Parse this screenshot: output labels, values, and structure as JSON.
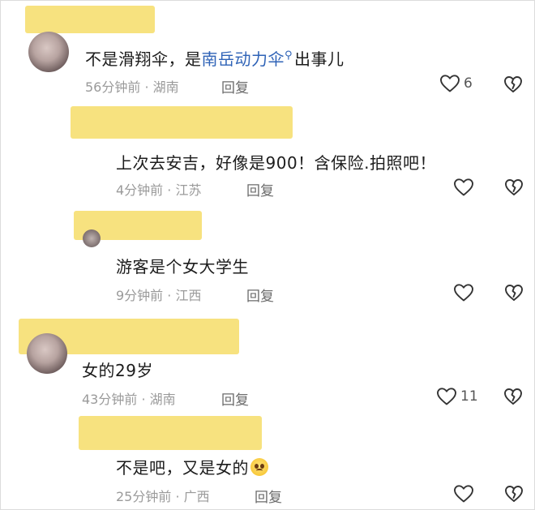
{
  "comments": [
    {
      "text_before": "不是滑翔伞，是",
      "link": "南岳动力伞",
      "text_after": "出事儿",
      "time": "56分钟前",
      "location": "湖南",
      "reply_label": "回复",
      "likes": "6"
    },
    {
      "text": "上次去安吉，好像是900！含保险.拍照吧！",
      "time": "4分钟前",
      "location": "江苏",
      "reply_label": "回复"
    },
    {
      "text": "游客是个女大学生",
      "time": "9分钟前",
      "location": "江西",
      "reply_label": "回复"
    },
    {
      "text": "女的29岁",
      "time": "43分钟前",
      "location": "湖南",
      "reply_label": "回复",
      "likes": "11"
    },
    {
      "text": "不是吧，又是女的",
      "time": "25分钟前",
      "location": "广西",
      "reply_label": "回复"
    }
  ],
  "meta_separator": " · ",
  "icons": {
    "like": "heart-outline-icon",
    "dislike": "broken-heart-icon",
    "search": "search-icon",
    "emoji": "pleading-face-emoji"
  },
  "colors": {
    "redaction": "#f7e27f",
    "link": "#2f63b7",
    "meta": "#9a9a9a"
  }
}
